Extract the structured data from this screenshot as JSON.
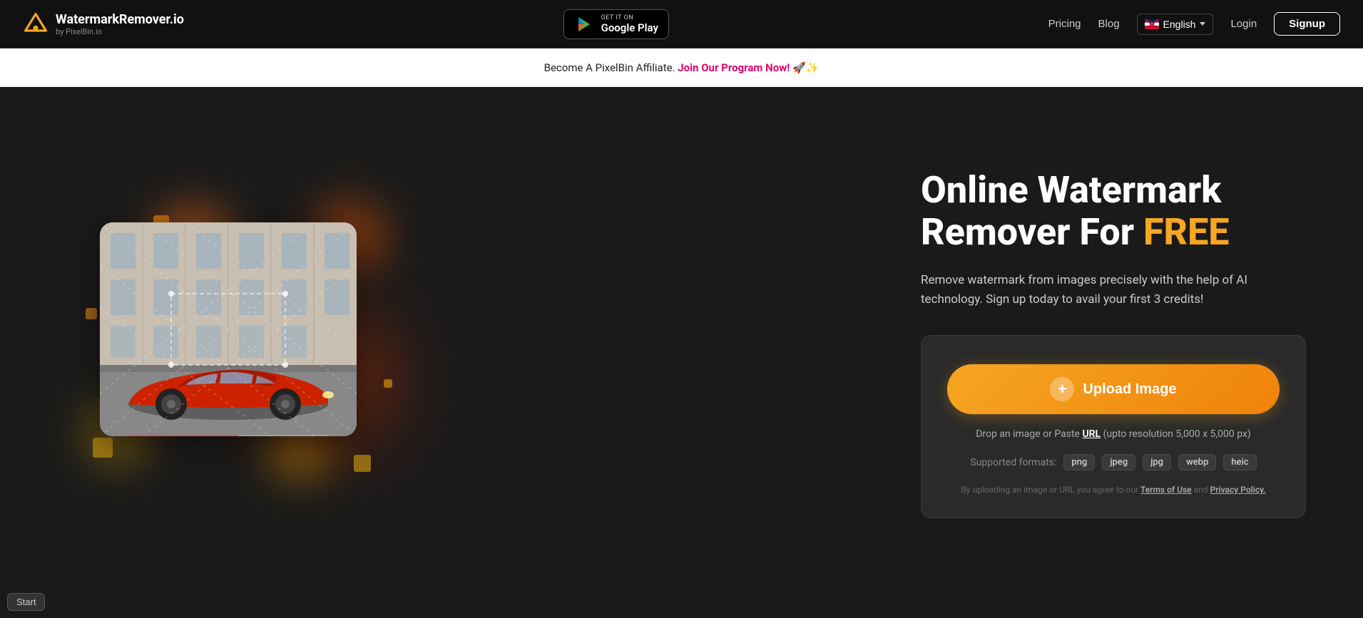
{
  "brand": {
    "name": "WatermarkRemover.io",
    "subtitle": "by PixelBin.io",
    "logo_alt": "logo"
  },
  "nav": {
    "google_play_get_it": "GET IT ON",
    "google_play_name": "Google Play",
    "pricing": "Pricing",
    "blog": "Blog",
    "language": "English",
    "login": "Login",
    "signup": "Signup"
  },
  "affiliate_banner": {
    "text": "Become A PixelBin Affiliate.",
    "cta": "Join Our Program Now!",
    "emoji": "🚀✨"
  },
  "hero": {
    "title_line1": "Online Watermark",
    "title_line2": "Remover For ",
    "title_free": "FREE",
    "subtitle": "Remove watermark from images precisely with the help of AI technology. Sign up today to avail your first 3 credits!",
    "upload_btn": "Upload Image",
    "drop_text": "Drop an image or Paste ",
    "url_label": "URL",
    "drop_suffix": " (upto resolution 5,000 x 5,000 px)",
    "formats_label": "Supported formats:",
    "formats": [
      "png",
      "jpeg",
      "jpg",
      "webp",
      "heic"
    ],
    "terms_text": "By uploading an image or URL you agree to our ",
    "terms_link": "Terms of Use",
    "and": " and ",
    "privacy_link": "Privacy Policy."
  },
  "start_btn": "Start"
}
